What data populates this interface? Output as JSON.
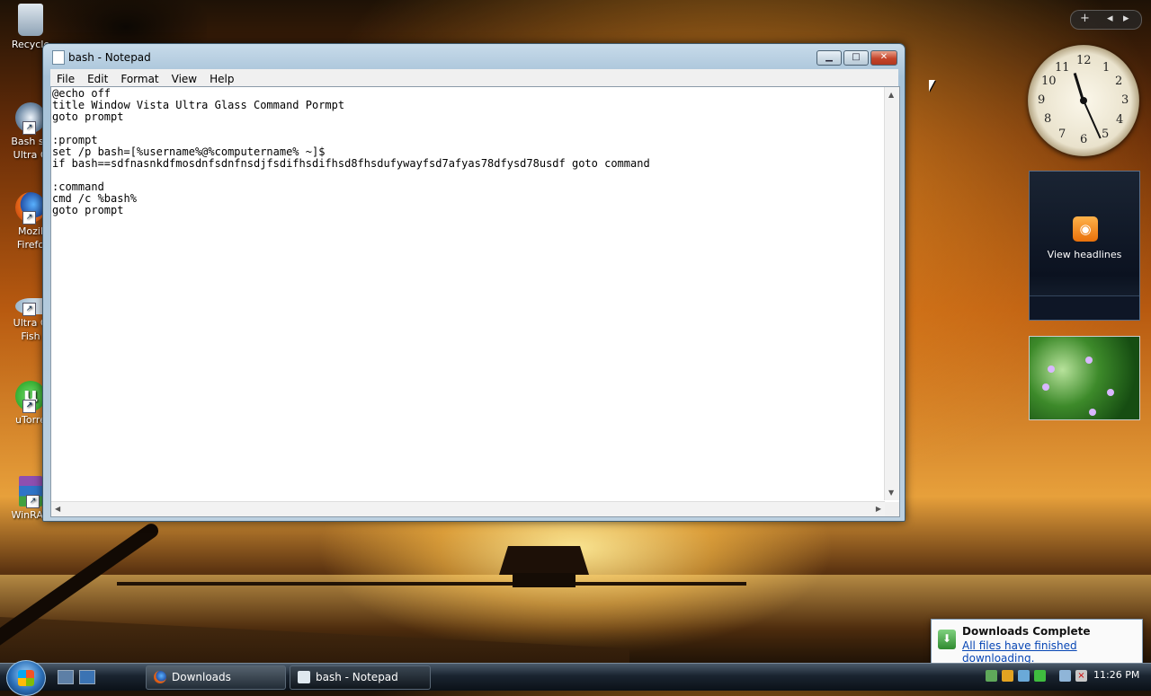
{
  "desktop": {
    "icons": [
      {
        "label": "Recycle"
      },
      {
        "label": "Bash sh Ultra G"
      },
      {
        "label": "Mozil Firefo"
      },
      {
        "label": "Ultra G Fish"
      },
      {
        "label": "uTorre"
      },
      {
        "label": "WinRAR"
      }
    ]
  },
  "window": {
    "title": "bash - Notepad",
    "controls": {
      "minimize": "▁",
      "maximize": "□",
      "close": "✕"
    },
    "menu": [
      "File",
      "Edit",
      "Format",
      "View",
      "Help"
    ],
    "content": "@echo off\ntitle Window Vista Ultra Glass Command Pormpt\ngoto prompt\n\n:prompt\nset /p bash=[%username%@%computername% ~]$\nif bash==sdfnasnkdfmosdnfsdnfnsdjfsdifhsdifhsd8fhsdufywayfsd7afyas78dfysd78usdf goto command\n\n:command\ncmd /c %bash%\ngoto prompt"
  },
  "gadgets": {
    "sidebar_controls": {
      "add": "+",
      "prev": "◂",
      "next": "▸"
    },
    "clock": {
      "numbers": [
        "12",
        "1",
        "2",
        "3",
        "4",
        "5",
        "6",
        "7",
        "8",
        "9",
        "10",
        "11"
      ],
      "time": "11:26"
    },
    "feed": {
      "label": "View headlines",
      "icon": "rss-icon"
    }
  },
  "notification": {
    "title": "Downloads Complete",
    "link": "All files have finished downloading."
  },
  "taskbar": {
    "buttons": [
      {
        "label": "Downloads",
        "icon": "firefox-icon"
      },
      {
        "label": "bash - Notepad",
        "icon": "notepad-icon"
      }
    ],
    "clock": "11:26 PM"
  },
  "colors": {
    "accent": "#0645b4",
    "close": "#c5442a"
  }
}
